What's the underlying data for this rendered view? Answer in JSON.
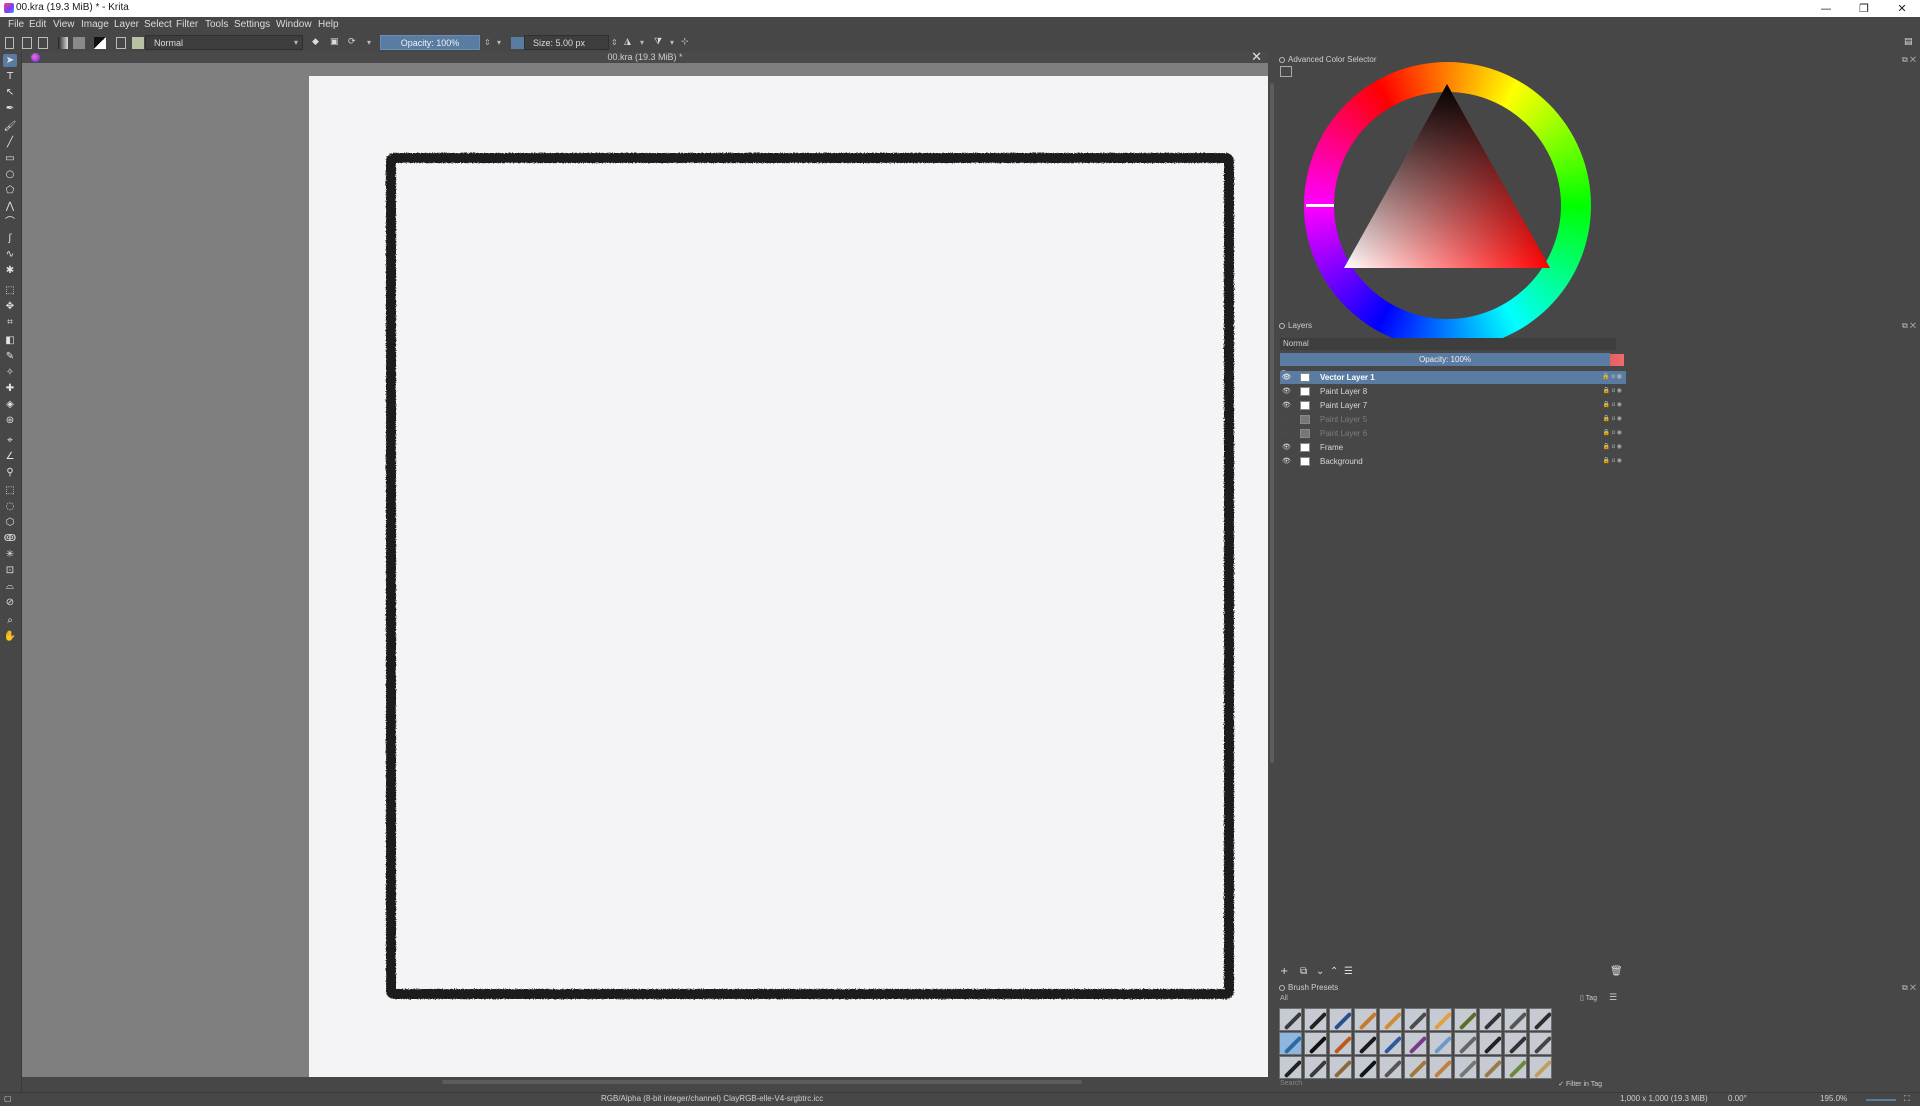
{
  "window": {
    "title": "00.kra (19.3 MiB) * - Krita",
    "controls": [
      "—",
      "❐",
      "✕"
    ]
  },
  "menu": [
    "File",
    "Edit",
    "View",
    "Image",
    "Layer",
    "Select",
    "Filter",
    "Tools",
    "Settings",
    "Window",
    "Help"
  ],
  "toolbar": {
    "blend_mode": "Normal",
    "opacity_label": "Opacity: 100%",
    "size_label": "Size: 5.00 px"
  },
  "document": {
    "tab_title": "00.kra (19.3 MiB) *"
  },
  "dockers": {
    "color_selector_title": "Advanced Color Selector",
    "layers_title": "Layers",
    "brush_presets_title": "Brush Presets"
  },
  "layers": {
    "blend_mode": "Normal",
    "opacity_label": "Opacity: 100%",
    "items": [
      {
        "name": "Vector Layer 1",
        "visible": true,
        "selected": true
      },
      {
        "name": "Paint Layer 8",
        "visible": true,
        "selected": false
      },
      {
        "name": "Paint Layer 7",
        "visible": true,
        "selected": false
      },
      {
        "name": "Paint Layer 5",
        "visible": false,
        "selected": false
      },
      {
        "name": "Paint Layer 6",
        "visible": false,
        "selected": false
      },
      {
        "name": "Frame",
        "visible": true,
        "selected": false
      },
      {
        "name": "Background",
        "visible": true,
        "selected": false
      }
    ]
  },
  "brush_presets": {
    "filter": "All",
    "tag_label": "Tag",
    "search_placeholder": "Search",
    "filter_in_tag": "Filter in Tag"
  },
  "status": {
    "color_space": "RGB/Alpha (8-bit integer/channel)  ClayRGB-elle-V4-srgbtrc.icc",
    "image_size": "1,000 x 1,000 (19.3 MiB)",
    "rotation": "0.00°",
    "zoom": "195.0%"
  },
  "colors": {
    "accent": "#5a7ca3",
    "ui_bg": "#474747",
    "canvas_bg": "#7f7f7f",
    "paper": "#f4f4f6"
  }
}
